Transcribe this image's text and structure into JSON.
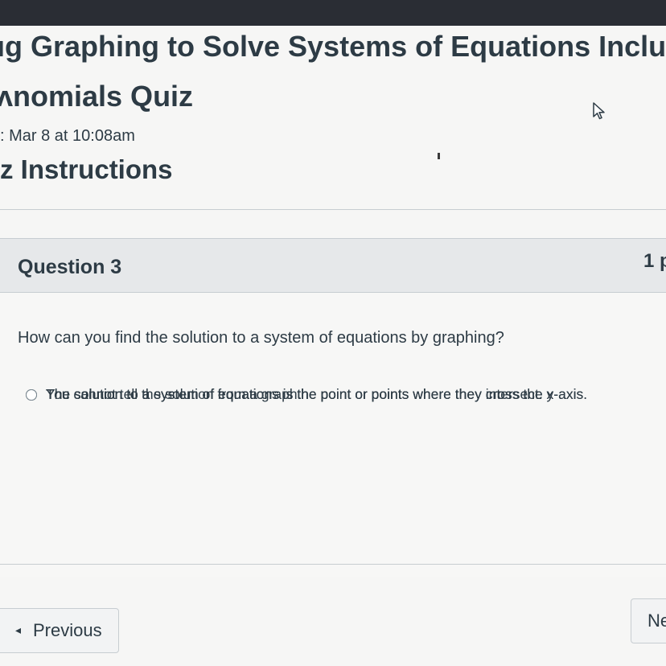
{
  "quiz": {
    "title_line1": "ıg Graphing to Solve Systems of Equations Incluc",
    "title_line2": "ʌnomials Quiz",
    "due": ": Mar 8 at 10:08am",
    "instructions_heading": "z Instructions"
  },
  "question": {
    "title": "Question 3",
    "points": "1 p",
    "text": "How can you find the solution to a system of equations by graphing?",
    "answers": [
      "The solution to a system of equations is the point or points where they cross the y-axis.",
      "You cannot tell the solution from a graph.",
      "The solution to a system of equations is the point or points where they intersect.",
      "The solution to a system of equations is the point or points where they cross the x-axis."
    ]
  },
  "nav": {
    "previous_icon": "chevron-left-icon",
    "previous_chevron": "◂",
    "previous_label": "Previous",
    "next_label": "Ne"
  },
  "icons": {
    "cursor": "mouse-cursor-icon",
    "radio": "radio-button-icon"
  },
  "colors": {
    "text": "#2d3b45",
    "header_band": "#e6e8ea",
    "top_bar": "#2a2d34"
  }
}
